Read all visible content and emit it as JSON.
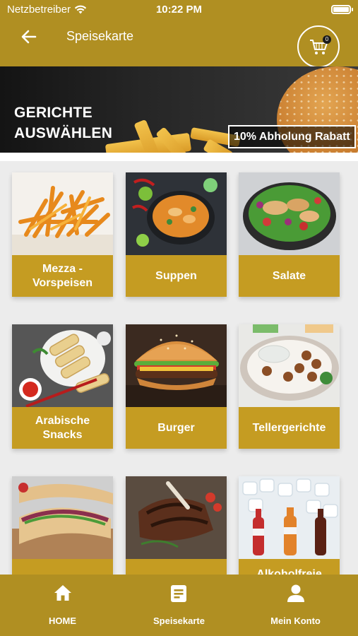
{
  "status_bar": {
    "carrier": "Netzbetreiber",
    "time": "10:22 PM"
  },
  "header": {
    "title": "Speisekarte",
    "cart_count": "0"
  },
  "banner": {
    "title_line1": "GERICHTE",
    "title_line2": "AUSWÄHLEN",
    "badge": "10% Abholung Rabatt"
  },
  "categories": [
    {
      "label": "Mezza -\nVorspeisen"
    },
    {
      "label": "Suppen"
    },
    {
      "label": "Salate"
    },
    {
      "label": "Arabische\nSnacks"
    },
    {
      "label": "Burger"
    },
    {
      "label": "Tellergerichte"
    },
    {
      "label": ""
    },
    {
      "label": ""
    },
    {
      "label": "Alkoholfreie"
    }
  ],
  "nav": {
    "home": "HOME",
    "menu": "Speisekarte",
    "account": "Mein Konto"
  },
  "colors": {
    "brand": "#b08f22",
    "card_label": "#c59c22"
  }
}
